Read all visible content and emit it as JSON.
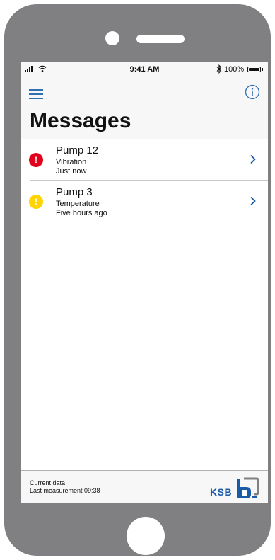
{
  "status_bar": {
    "time": "9:41 AM",
    "battery_text": "100%"
  },
  "header": {
    "title": "Messages",
    "menu_icon": "hamburger-menu-icon",
    "info_icon": "info-circle-icon"
  },
  "messages": [
    {
      "title": "Pump 12",
      "subtitle": "Vibration",
      "time": "Just now",
      "severity": "alarm",
      "severity_color": "#e2001a"
    },
    {
      "title": "Pump 3",
      "subtitle": "Temperature",
      "time": "Five hours ago",
      "severity": "warning",
      "severity_color": "#ffd400"
    }
  ],
  "footer": {
    "line1": "Current data",
    "line2": "Last measurement 09:38",
    "brand": "KSB"
  },
  "colors": {
    "accent": "#2f6fb3",
    "brand_blue": "#1b5aa6",
    "device_frame": "#808082",
    "background_light": "#f7f7f7"
  }
}
